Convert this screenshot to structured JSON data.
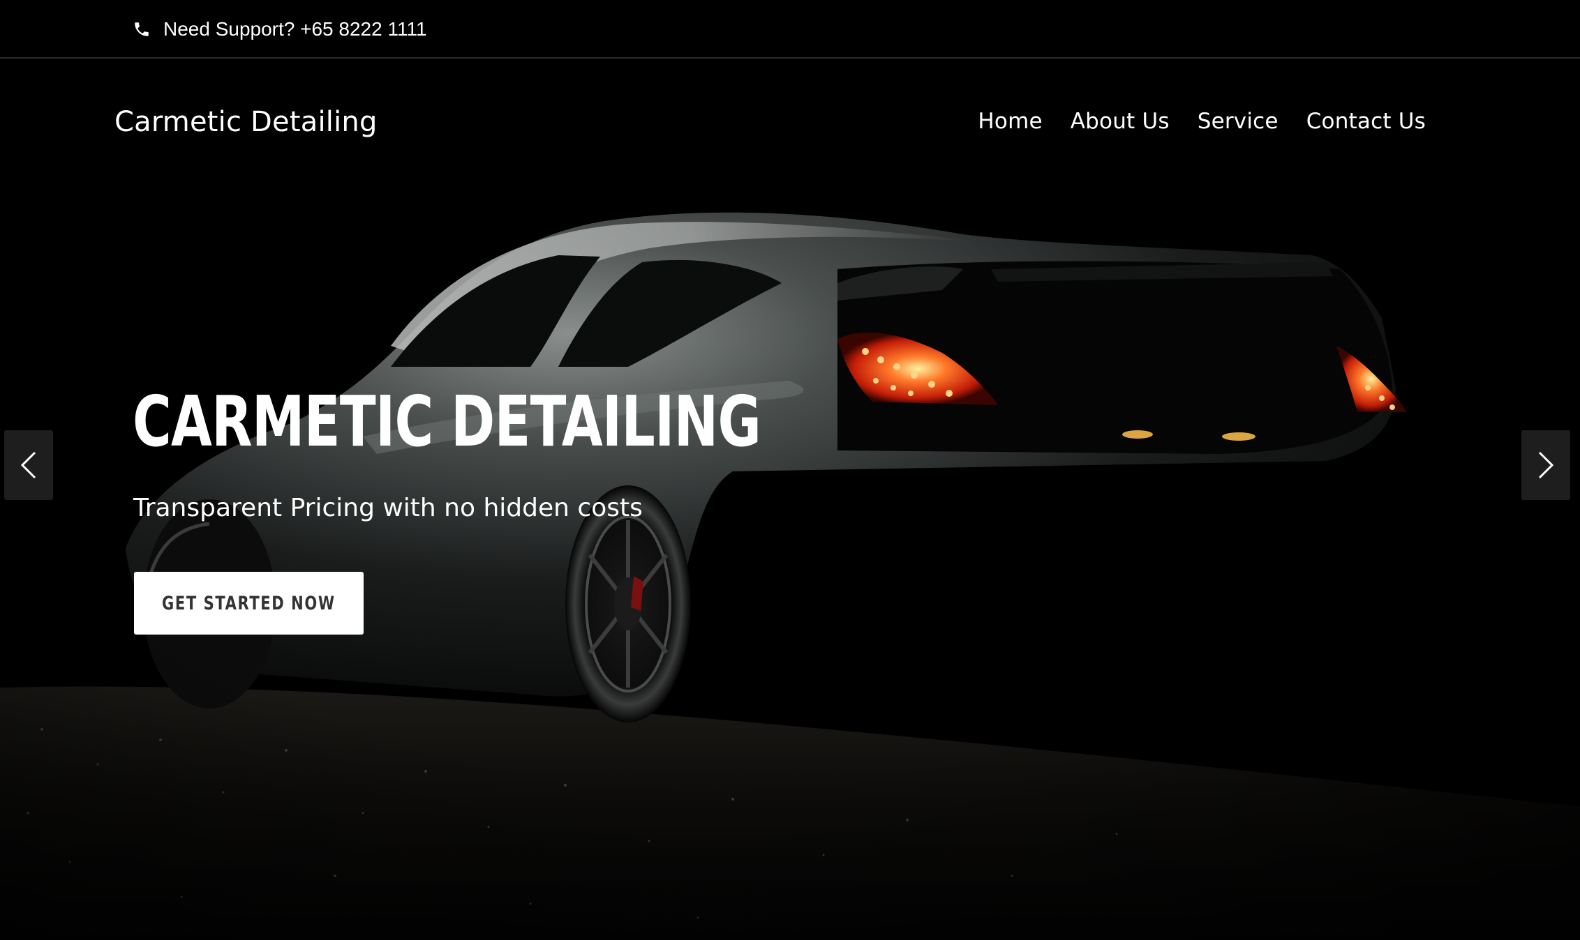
{
  "topbar": {
    "phone_icon": "phone-icon",
    "support_text": "Need Support? +65 8222 1111"
  },
  "header": {
    "brand": "Carmetic Detailing",
    "nav": [
      {
        "label": "Home"
      },
      {
        "label": "About Us"
      },
      {
        "label": "Service"
      },
      {
        "label": "Contact Us"
      }
    ]
  },
  "hero": {
    "title": "CARMETIC DETAILING",
    "subtitle": "Transparent Pricing with no hidden costs",
    "cta_label": "GET STARTED NOW",
    "prev_icon": "chevron-left-icon",
    "next_icon": "chevron-right-icon"
  },
  "colors": {
    "background": "#000000",
    "text": "#ffffff",
    "cta_background": "#ffffff",
    "cta_text": "#333333",
    "taillight": "#ff4a1a"
  }
}
